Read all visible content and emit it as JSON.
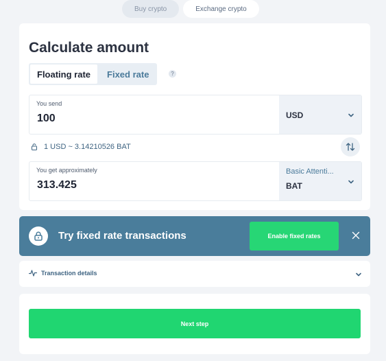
{
  "top_tabs": [
    {
      "label": "Buy crypto"
    },
    {
      "label": "Exchange crypto"
    }
  ],
  "calculator": {
    "title": "Calculate amount",
    "rate_modes": [
      {
        "label": "Floating rate",
        "selected": true
      },
      {
        "label": "Fixed rate",
        "selected": false
      }
    ],
    "help": "?",
    "send": {
      "label": "You send",
      "value": "100",
      "currency_code": "USD"
    },
    "rate_text": "1 USD ~ 3.14210526 BAT",
    "receive": {
      "label": "You get approximately",
      "value": "313.425",
      "currency_name": "Basic Attenti...",
      "currency_code": "BAT"
    }
  },
  "promo": {
    "text": "Try fixed rate transactions",
    "button_label": "Enable fixed rates"
  },
  "details": {
    "label": "Transaction details"
  },
  "next": {
    "label": "Next step"
  },
  "colors": {
    "accent_green": "#20d671",
    "promo_blue": "#4a7d9b",
    "link_blue": "#3f6482"
  }
}
